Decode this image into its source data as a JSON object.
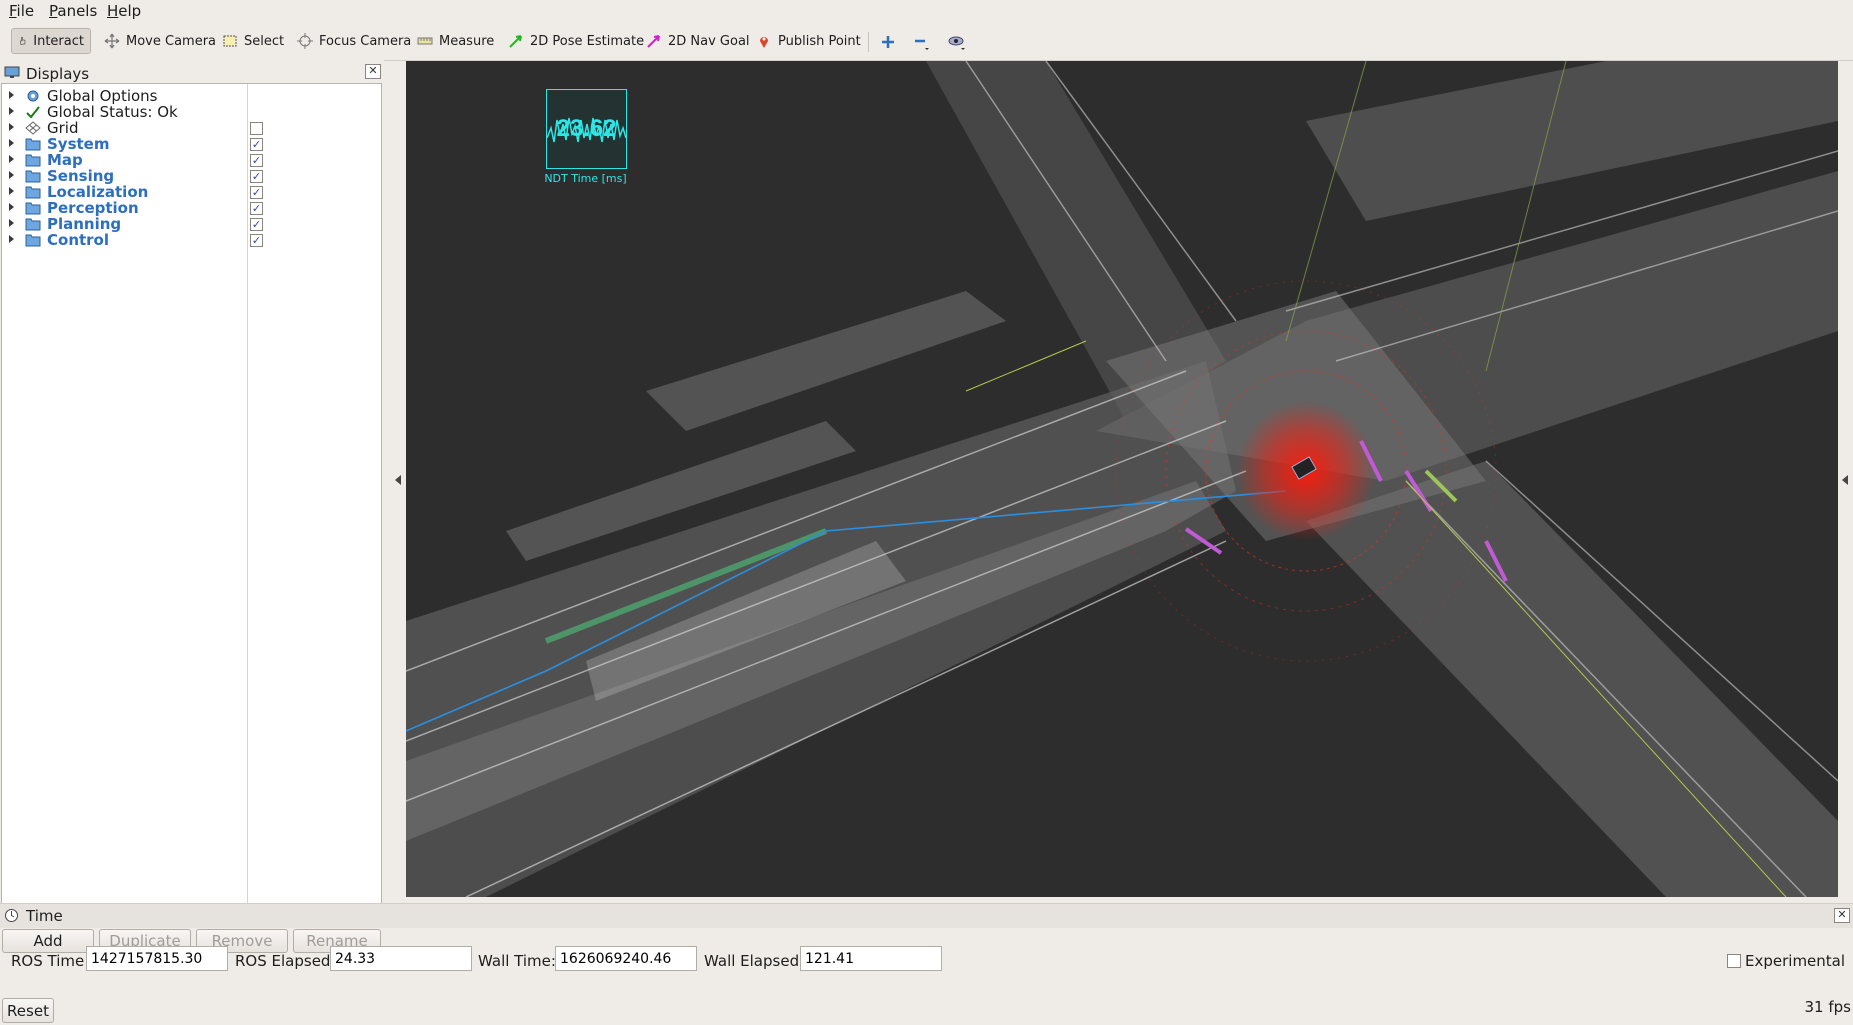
{
  "menu": [
    "File",
    "Panels",
    "Help"
  ],
  "toolbar": {
    "tools": [
      {
        "label": "Interact",
        "icon": "hand-icon"
      },
      {
        "label": "Move Camera",
        "icon": "move-camera-icon"
      },
      {
        "label": "Select",
        "icon": "select-icon"
      },
      {
        "label": "Focus Camera",
        "icon": "focus-camera-icon"
      },
      {
        "label": "Measure",
        "icon": "ruler-icon"
      },
      {
        "label": "2D Pose Estimate",
        "icon": "green-arrow-icon"
      },
      {
        "label": "2D Nav Goal",
        "icon": "magenta-arrow-icon"
      },
      {
        "label": "Publish Point",
        "icon": "map-pin-icon"
      }
    ]
  },
  "displays": {
    "title": "Displays",
    "items": [
      {
        "label": "Global Options",
        "icon": "gear-icon",
        "folder": false,
        "checkbox": null
      },
      {
        "label": "Global Status: Ok",
        "icon": "check-icon",
        "folder": false,
        "checkbox": null
      },
      {
        "label": "Grid",
        "icon": "grid-icon",
        "folder": false,
        "checkbox": "unchecked"
      },
      {
        "label": "System",
        "icon": "folder-icon",
        "folder": true,
        "checkbox": "checked"
      },
      {
        "label": "Map",
        "icon": "folder-icon",
        "folder": true,
        "checkbox": "checked"
      },
      {
        "label": "Sensing",
        "icon": "folder-icon",
        "folder": true,
        "checkbox": "checked"
      },
      {
        "label": "Localization",
        "icon": "folder-icon",
        "folder": true,
        "checkbox": "checked"
      },
      {
        "label": "Perception",
        "icon": "folder-icon",
        "folder": true,
        "checkbox": "checked"
      },
      {
        "label": "Planning",
        "icon": "folder-icon",
        "folder": true,
        "checkbox": "checked"
      },
      {
        "label": "Control",
        "icon": "folder-icon",
        "folder": true,
        "checkbox": "checked"
      }
    ],
    "buttons": {
      "add": "Add",
      "duplicate": "Duplicate",
      "remove": "Remove",
      "rename": "Rename"
    }
  },
  "overlay": {
    "ndt_value": "23.62",
    "ndt_label": "NDT Time [ms]"
  },
  "time": {
    "title": "Time",
    "ros_time_label": "ROS Time:",
    "ros_time": "1427157815.30",
    "ros_elapsed_label": "ROS Elapsed:",
    "ros_elapsed": "24.33",
    "wall_time_label": "Wall Time:",
    "wall_time": "1626069240.46",
    "wall_elapsed_label": "Wall Elapsed:",
    "wall_elapsed": "121.41",
    "experimental_label": "Experimental",
    "reset_label": "Reset"
  },
  "fps": "31 fps",
  "colors": {
    "folder_text": "#2d6ebe",
    "viewport_bg": "#2d2d2d",
    "ndt_cyan": "#2ee6e6",
    "lidar_red": "#ff2a1a"
  }
}
